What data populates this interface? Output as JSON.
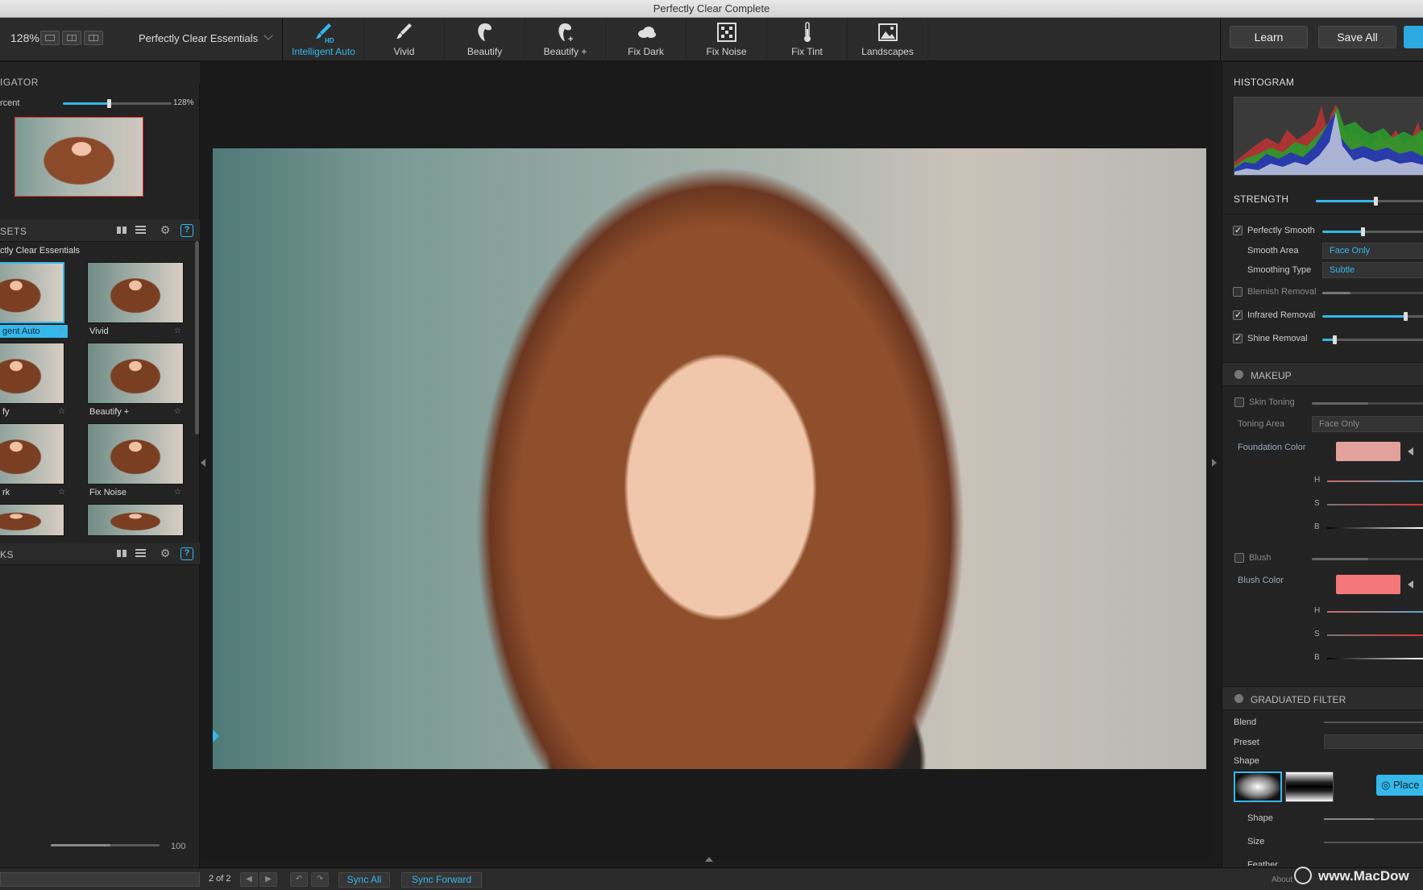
{
  "window": {
    "title": "Perfectly Clear Complete"
  },
  "toolbar": {
    "zoom": "128%",
    "preset_select": "Perfectly Clear Essentials",
    "tools": [
      {
        "label": "Intelligent Auto",
        "icon": "brush-hd-icon",
        "active": true
      },
      {
        "label": "Vivid",
        "icon": "brush-icon",
        "active": false
      },
      {
        "label": "Beautify",
        "icon": "beautify-face-icon",
        "active": false
      },
      {
        "label": "Beautify +",
        "icon": "beautify-plus-icon",
        "active": false
      },
      {
        "label": "Fix Dark",
        "icon": "cloud-dark-icon",
        "active": false
      },
      {
        "label": "Fix Noise",
        "icon": "noise-grid-icon",
        "active": false
      },
      {
        "label": "Fix Tint",
        "icon": "thermometer-icon",
        "active": false
      },
      {
        "label": "Landscapes",
        "icon": "landscape-icon",
        "active": false
      }
    ],
    "learn": "Learn",
    "save_all": "Save All"
  },
  "left": {
    "navigator_title": "IGATOR",
    "percent_label": "rcent",
    "percent_value": "128%",
    "presets_title": "SETS",
    "preset_group": "ctly Clear Essentials",
    "presets": [
      {
        "label": "gent Auto",
        "selected": true
      },
      {
        "label": "Vivid",
        "selected": false
      },
      {
        "label": "fy",
        "selected": false
      },
      {
        "label": "Beautify +",
        "selected": false
      },
      {
        "label": "rk",
        "selected": false
      },
      {
        "label": "Fix Noise",
        "selected": false
      }
    ],
    "looks_title": "KS",
    "bottom_slider_value": "100"
  },
  "right": {
    "histogram_title": "HISTOGRAM",
    "strength_title": "STRENGTH",
    "perfectly_smooth": "Perfectly Smooth",
    "smooth_area_label": "Smooth Area",
    "smooth_area_value": "Face Only",
    "smoothing_type_label": "Smoothing Type",
    "smoothing_type_value": "Subtle",
    "blemish_removal": "Blemish Removal",
    "infrared_removal": "Infrared Removal",
    "shine_removal": "Shine Removal",
    "makeup_title": "MAKEUP",
    "skin_toning": "Skin Toning",
    "toning_area_label": "Toning Area",
    "toning_area_value": "Face Only",
    "foundation_color_label": "Foundation Color",
    "blush": "Blush",
    "blush_color_label": "Blush Color",
    "h": "H",
    "s": "S",
    "b": "B",
    "graduated_title": "GRADUATED FILTER",
    "blend": "Blend",
    "preset": "Preset",
    "shape": "Shape",
    "place_button": "Place C",
    "shape_row": "Shape",
    "size_row": "Size",
    "feather_row": "Feather"
  },
  "status": {
    "count": "2 of 2",
    "sync_all": "Sync All",
    "sync_forward": "Sync Forward",
    "about": "About",
    "watermark": "www.MacDow"
  },
  "colors": {
    "accent": "#35b8ea",
    "foundation": "#e3a19c",
    "blush": "#f47779"
  },
  "levels": {
    "navigator_zoom": 0.42,
    "strength": 0.55,
    "perfectly_smooth": 0.4,
    "blemish_removal": 0.28,
    "infrared_removal": 0.82,
    "shine_removal": 0.12,
    "bottom_slider": 0.55
  }
}
